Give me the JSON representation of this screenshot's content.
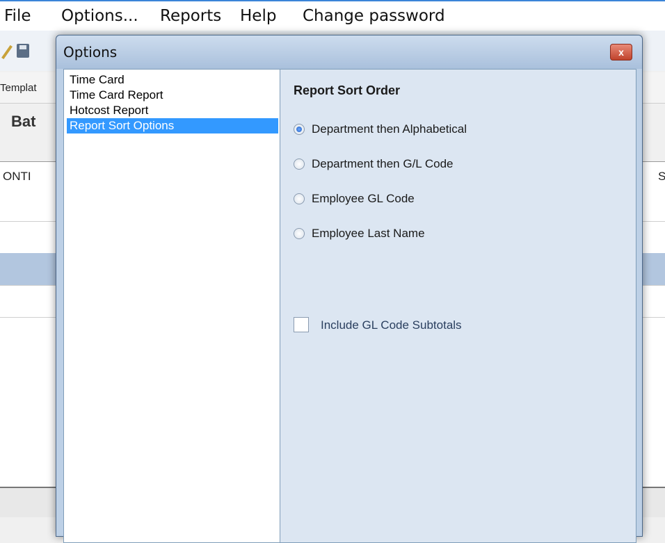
{
  "menubar": {
    "items": [
      "File",
      "Options...",
      "Reports",
      "Help",
      "Change password"
    ]
  },
  "background": {
    "tab_label": "Templat",
    "title": "Bat",
    "col_header_left": "ONTI",
    "col_header_right": "S"
  },
  "dialog": {
    "title": "Options",
    "close_label": "x",
    "nav": {
      "items": [
        "Time Card",
        "Time Card Report",
        "Hotcost Report",
        "Report Sort Options"
      ],
      "selected": "Report Sort Options"
    },
    "panel": {
      "section_title": "Report Sort Order",
      "radios": [
        {
          "label": "Department then Alphabetical",
          "checked": true
        },
        {
          "label": "Department then G/L Code",
          "checked": false
        },
        {
          "label": "Employee GL Code",
          "checked": false
        },
        {
          "label": "Employee Last Name",
          "checked": false
        }
      ],
      "checkbox_label": "Include GL Code Subtotals",
      "checkbox_checked": false
    }
  },
  "colors": {
    "selection": "#3399ff",
    "dialog_bg": "#dce6f2",
    "accent": "#3a84d8"
  }
}
